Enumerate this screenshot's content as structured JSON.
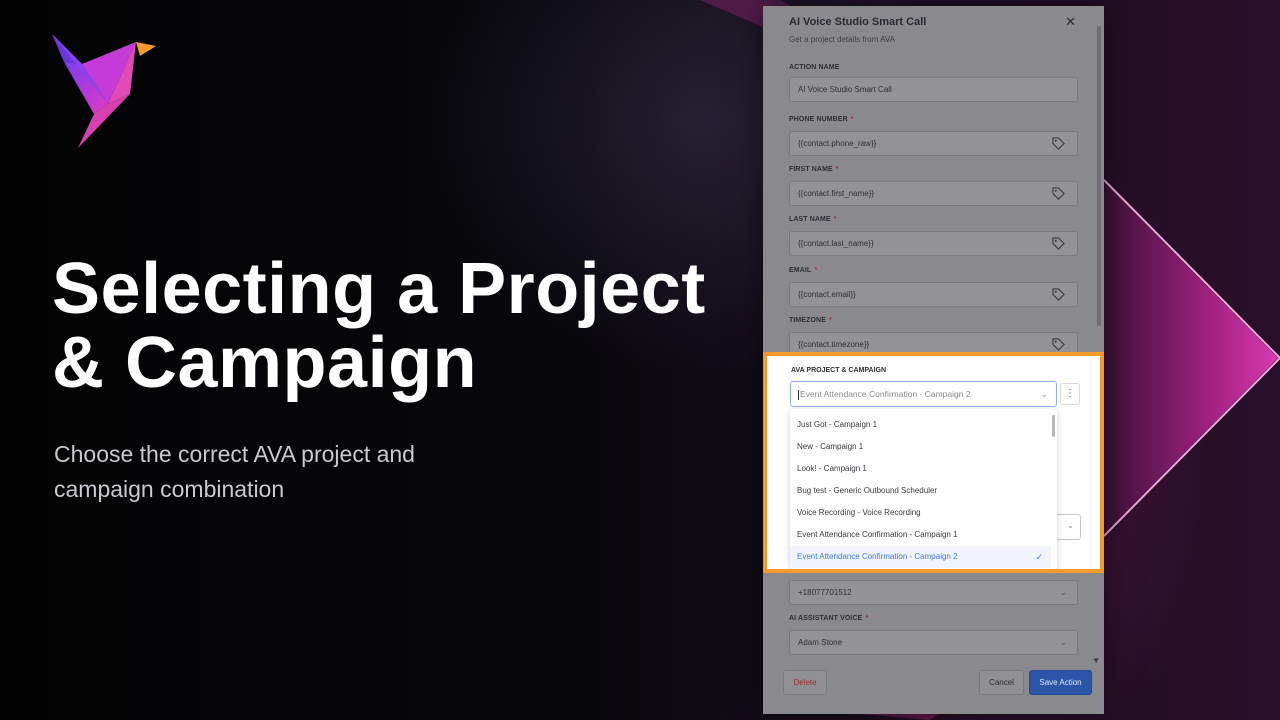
{
  "colors": {
    "accent_orange": "#f39a2a",
    "logo_pink": "#e33ac5",
    "logo_purple": "#7a3cf0",
    "save_blue": "#2c55aa",
    "select_blue": "#3f7be0"
  },
  "hero": {
    "title_line1": "Selecting a Project",
    "title_line2": "& Campaign",
    "subtitle_line1": "Choose the correct AVA project and",
    "subtitle_line2": "campaign combination"
  },
  "logo": {
    "icon": "bird-logo-icon"
  },
  "panel": {
    "title": "AI Voice Studio Smart Call",
    "subtitle": "Get a project details from AVA",
    "close_glyph": "✕",
    "fields": {
      "action_name": {
        "label": "ACTION NAME",
        "value": "AI Voice Studio Smart Call"
      },
      "phone_number": {
        "label": "PHONE NUMBER",
        "required": "*",
        "value": "{{contact.phone_raw}}"
      },
      "first_name": {
        "label": "FIRST NAME",
        "required": "*",
        "value": "{{contact.first_name}}"
      },
      "last_name": {
        "label": "LAST NAME",
        "required": "*",
        "value": "{{contact.last_name}}"
      },
      "email": {
        "label": "EMAIL",
        "required": "*",
        "value": "{{contact.email}}"
      },
      "timezone": {
        "label": "TIMEZONE",
        "required": "*",
        "value": "{{contact.timezone}}"
      },
      "from_number": {
        "value": "+18077701512"
      },
      "assistant_voice": {
        "label": "AI ASSISTANT VOICE",
        "required": "*",
        "value": "Adam Stone"
      }
    },
    "project_campaign": {
      "label": "AVA PROJECT & CAMPAIGN",
      "placeholder": "Event Attendance Confirmation - Campaign 2",
      "options": [
        "Just Got - Campaign 1",
        "New - Campaign 1",
        "Look! - Campaign 1",
        "Bug test - Generic Outbound Scheduler",
        "Voice Recording - Voice Recording",
        "Event Attendance Confirmation - Campaign 1",
        "Event Attendance Confirmation - Campaign 2"
      ],
      "selected_index": 6
    },
    "buttons": {
      "delete": "Delete",
      "cancel": "Cancel",
      "save": "Save Action"
    }
  }
}
